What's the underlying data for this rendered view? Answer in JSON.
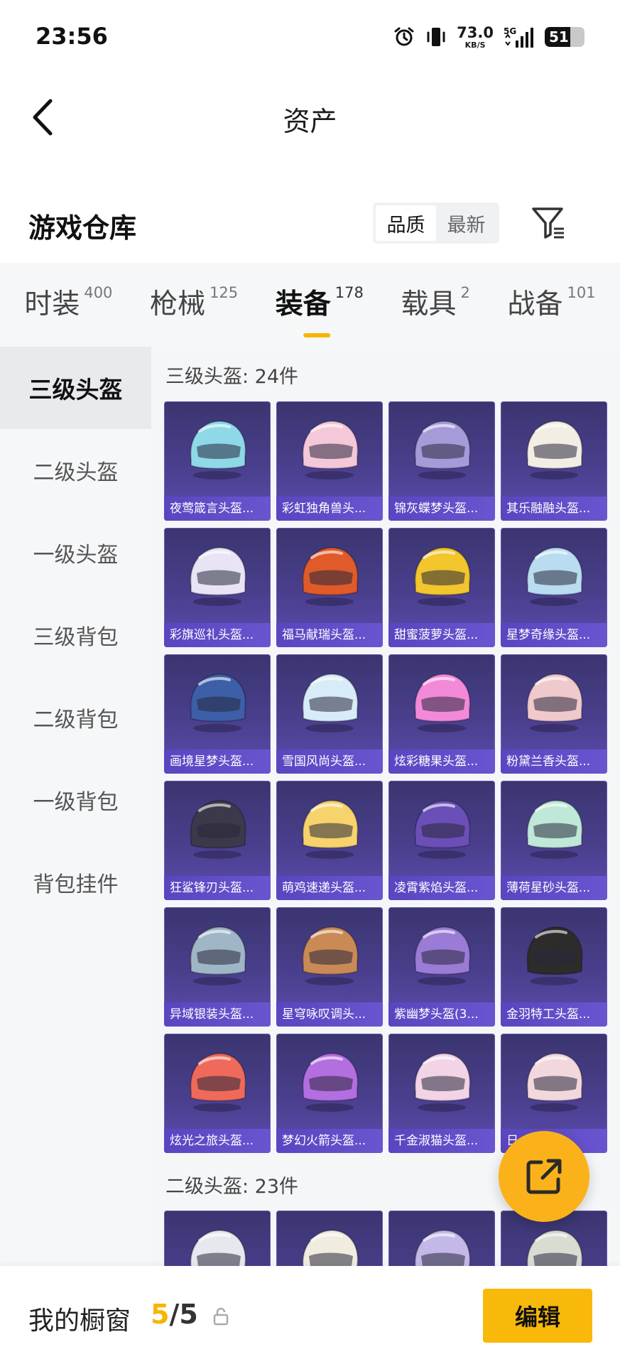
{
  "status_bar": {
    "time": "23:56",
    "net_speed": "73.0",
    "net_unit": "KB/S",
    "network": "5G",
    "battery": "51"
  },
  "header": {
    "title": "资产"
  },
  "section": {
    "title": "游戏仓库",
    "sort_options": [
      "品质",
      "最新"
    ],
    "sort_active": "品质"
  },
  "tabs": [
    {
      "label": "时装",
      "count": "400"
    },
    {
      "label": "枪械",
      "count": "125"
    },
    {
      "label": "装备",
      "count": "178"
    },
    {
      "label": "载具",
      "count": "2"
    },
    {
      "label": "战备",
      "count": "101"
    }
  ],
  "active_tab": "装备",
  "sidebar": {
    "items": [
      "三级头盔",
      "二级头盔",
      "一级头盔",
      "三级背包",
      "二级背包",
      "一级背包",
      "背包挂件"
    ],
    "active": "三级头盔"
  },
  "groups": [
    {
      "title": "三级头盔: 24件",
      "items": [
        {
          "name": "夜莺箴言头盔...",
          "color": "#8fd8e8"
        },
        {
          "name": "彩虹独角兽头...",
          "color": "#f4c8d8"
        },
        {
          "name": "锦灰蝶梦头盔...",
          "color": "#a69bd9"
        },
        {
          "name": "其乐融融头盔...",
          "color": "#f3eee4"
        },
        {
          "name": "彩旗巡礼头盔...",
          "color": "#e8e4f5"
        },
        {
          "name": "福马献瑞头盔...",
          "color": "#e05a2a"
        },
        {
          "name": "甜蜜菠萝头盔...",
          "color": "#f2c62c"
        },
        {
          "name": "星梦奇缘头盔...",
          "color": "#b9dcf0"
        },
        {
          "name": "画境星梦头盔...",
          "color": "#3d5fa8"
        },
        {
          "name": "雪国风尚头盔...",
          "color": "#d7ecf6"
        },
        {
          "name": "炫彩糖果头盔...",
          "color": "#f28ad9"
        },
        {
          "name": "粉黛兰香头盔...",
          "color": "#f0c9cc"
        },
        {
          "name": "狂鲨锋刃头盔...",
          "color": "#3c3a4a"
        },
        {
          "name": "萌鸡速递头盔...",
          "color": "#f6d36c"
        },
        {
          "name": "凌霄紫焰头盔...",
          "color": "#6b4fb8"
        },
        {
          "name": "薄荷星砂头盔...",
          "color": "#bfe8d8"
        },
        {
          "name": "异域银装头盔...",
          "color": "#9fb6c6"
        },
        {
          "name": "星穹咏叹调头...",
          "color": "#c98a56"
        },
        {
          "name": "紫幽梦头盔(3...",
          "color": "#9a7bd6"
        },
        {
          "name": "金羽特工头盔...",
          "color": "#2e2c2a"
        },
        {
          "name": "炫光之旅头盔...",
          "color": "#ef6a5a"
        },
        {
          "name": "梦幻火箭头盔...",
          "color": "#b36ee0"
        },
        {
          "name": "千金淑猫头盔...",
          "color": "#f2d4e6"
        },
        {
          "name": "日...头盔...",
          "color": "#f2d8dc"
        }
      ]
    },
    {
      "title": "二级头盔: 23件",
      "items": [
        {
          "name": "",
          "color": "#e6e8ee"
        },
        {
          "name": "",
          "color": "#f1ece0"
        },
        {
          "name": "",
          "color": "#c3b8e8"
        },
        {
          "name": "",
          "color": "#d8ddd2"
        }
      ]
    }
  ],
  "bottom_bar": {
    "label": "我的橱窗",
    "used": "5",
    "separator": "/",
    "total": "5",
    "edit_label": "编辑"
  }
}
